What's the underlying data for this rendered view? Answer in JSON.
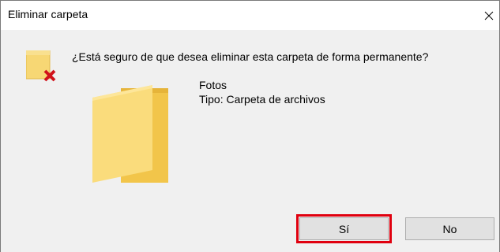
{
  "dialog": {
    "title": "Eliminar carpeta",
    "question": "¿Está seguro de que desea eliminar esta carpeta de forma permanente?",
    "item": {
      "name": "Fotos",
      "type": "Tipo: Carpeta de archivos"
    },
    "buttons": {
      "yes_label": "Sí",
      "no_label": "No"
    },
    "highlight_color": "#e0000f",
    "folder_color": "#f7d774"
  },
  "icons": {
    "close": "close-icon",
    "warning": "folder-delete-icon",
    "folder": "folder-icon"
  }
}
